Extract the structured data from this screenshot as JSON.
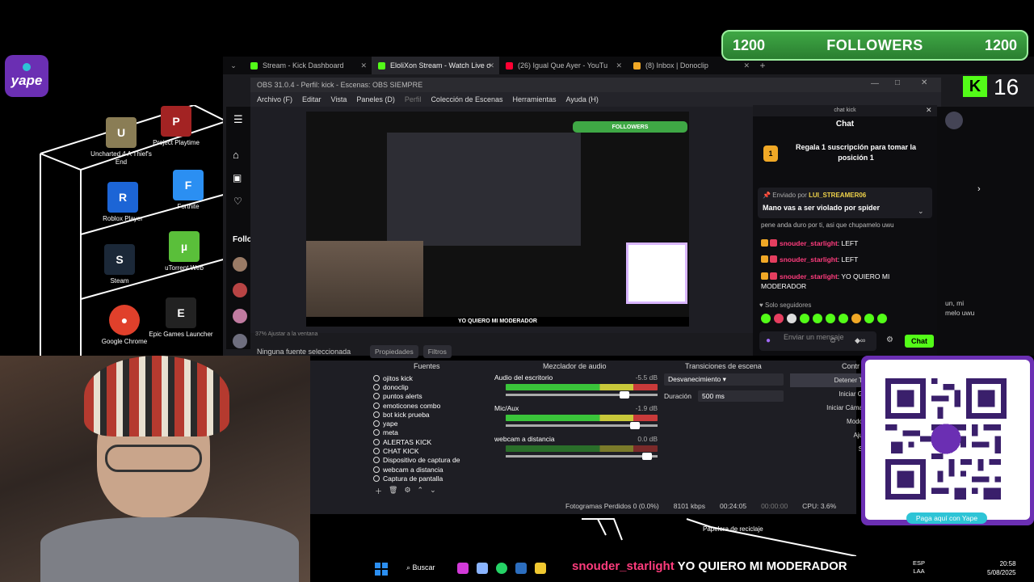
{
  "desktop": {
    "icons": [
      {
        "label": "Uncharted 4 A Thief's End",
        "color": "#8a7d55"
      },
      {
        "label": "Project Playtime",
        "color": "#a32323"
      },
      {
        "label": "Roblox Player",
        "color": "#1c65d6"
      },
      {
        "label": "Fortnite",
        "color": "#2b8ff2"
      },
      {
        "label": "Steam",
        "color": "#1b2838"
      },
      {
        "label": "uTorrent Web",
        "color": "#5abf3a"
      },
      {
        "label": "Google Chrome",
        "color": "#e0402b"
      },
      {
        "label": "Epic Games Launcher",
        "color": "#222"
      }
    ],
    "yape_logo": "yape",
    "recycle_bin": "Papelera de reciclaje"
  },
  "browser": {
    "tabs": [
      {
        "label": "Stream - Kick Dashboard",
        "favicon_color": "#53fc18",
        "active": false
      },
      {
        "label": "EloliXon Stream - Watch Live o",
        "favicon_color": "#53fc18",
        "active": true
      },
      {
        "label": "(26) Igual Que Ayer - YouTu",
        "favicon_color": "#ff0033",
        "active": false
      },
      {
        "label": "(8) Inbox | Donoclip",
        "favicon_color": "#f0a826",
        "active": false
      }
    ]
  },
  "followers_banner": {
    "left_count": "1200",
    "title": "FOLLOWERS",
    "right_count": "1200"
  },
  "kick_counter": {
    "badge": "K",
    "count": "16"
  },
  "kick_site": {
    "following_label": "Follo"
  },
  "obs": {
    "title": "OBS 31.0.4 - Perfil: kick - Escenas: OBS SIEMPRE",
    "menu": [
      "Archivo (F)",
      "Editar",
      "Vista",
      "Paneles (D)",
      "Perfil",
      "Colección de Escenas",
      "Herramientas",
      "Ayuda (H)"
    ],
    "zoom_label": "37%  Ajustar a la ventana",
    "no_source": "Ninguna fuente seleccionada",
    "properties_btn": "Propiedades",
    "filters_btn": "Filtros",
    "docks": {
      "sources": "Fuentes",
      "mixer": "Mezclador de audio",
      "transitions": "Transiciones de escena",
      "controls": "Contr"
    },
    "preview_banner": "FOLLOWERS",
    "preview_ticker": "YO QUIERO MI MODERADOR",
    "sources": [
      "ojitos kick",
      "donoclip",
      "puntos alerts",
      "emoticones combo",
      "bot kick prueba",
      "yape",
      "meta",
      "ALERTAS KICK",
      "CHAT KICK",
      "Dispositivo de captura de",
      "webcam a distancia",
      "Captura de pantalla"
    ],
    "mixer": [
      {
        "name": "Audio del escritorio",
        "db": "-5.5 dB",
        "level": 0.75,
        "active": true
      },
      {
        "name": "Mic/Aux",
        "db": "-1.9 dB",
        "level": 0.82,
        "active": true
      },
      {
        "name": "webcam a distancia",
        "db": "0.0 dB",
        "level": 0.9,
        "active": false
      }
    ],
    "transition": {
      "type": "Desvanecimiento",
      "duration_label": "Duración",
      "duration": "500 ms"
    },
    "controls": [
      "Detener T",
      "Iniciar G",
      "Iniciar Cáma",
      "Modo",
      "Aju",
      "S"
    ],
    "status": {
      "dropped": "Fotogramas Perdidos 0 (0.0%)",
      "bitrate": "8101 kbps",
      "live_time": "00:24:05",
      "rec_time": "00:00:00",
      "cpu": "CPU: 3.6%"
    }
  },
  "chat": {
    "window_title": "chat kick",
    "title": "Chat",
    "gift_badge": "1",
    "gift_text": "Regala 1 suscripción para tomar la posición 1",
    "pinned_by_prefix": "Enviado por",
    "pinned_by_user": "LUI_STREAMER06",
    "pinned_message": "Mano vas a ser violado por spider",
    "old_line": "pene anda duro por ti, asi que chupamelo uwu",
    "messages": [
      {
        "user": "snouder_starlight",
        "text": ": LEFT"
      },
      {
        "user": "snouder_starlight",
        "text": ": LEFT"
      },
      {
        "user": "snouder_starlight",
        "text": ": YO QUIERO MI MODERADOR"
      }
    ],
    "followers_only": "Solo seguidores",
    "input_placeholder": "Enviar un mensaje",
    "send_btn": "Chat",
    "right_strip_lines": [
      "un, mi",
      "melo uwu"
    ]
  },
  "qr": {
    "brand": "yape",
    "label": "Paga aquí con Yape"
  },
  "taskbar": {
    "search": "Buscar",
    "ticker_user": "snouder_starlight",
    "ticker_text": "YO QUIERO MI MODERADOR",
    "lang": "ESP",
    "region": "LAA",
    "time": "20:58",
    "date": "5/08/2025"
  }
}
